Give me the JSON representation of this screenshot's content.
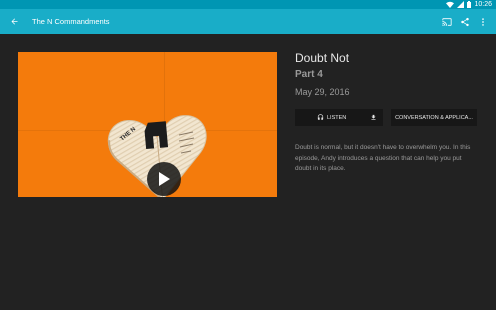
{
  "status_bar": {
    "time": "10:26",
    "icons": [
      "wifi-icon",
      "signal-icon",
      "battery-icon"
    ]
  },
  "app_bar": {
    "title": "The N Commandments",
    "back_icon": "back-arrow-icon",
    "actions": [
      "cast-icon",
      "share-icon",
      "more-vert-icon"
    ]
  },
  "video": {
    "artwork_letters": "THE N",
    "play_icon": "play-icon"
  },
  "episode": {
    "title": "Doubt Not",
    "part": "Part 4",
    "date": "May 29, 2016",
    "description": "Doubt is normal, but it doesn't have to overwhelm you. In this episode, Andy introduces a question that can help you put doubt in its place."
  },
  "buttons": {
    "listen": "LISTEN",
    "conversation": "CONVERSATION & APPLICA..."
  },
  "colors": {
    "accent": "#19adc8",
    "status_bar": "#0096b3",
    "background": "#222222",
    "artwork": "#f47b0c"
  }
}
